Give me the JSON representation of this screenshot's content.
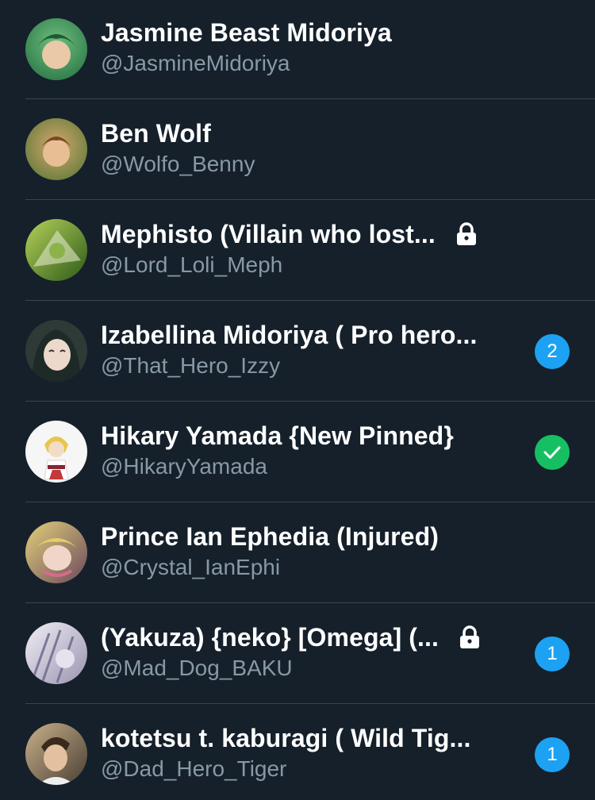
{
  "accounts": [
    {
      "name": "Jasmine Beast Midoriya",
      "handle": "@JasmineMidoriya",
      "locked": false,
      "badge": null,
      "avatar_colors": [
        "#2f7a4a",
        "#6fbf7f"
      ]
    },
    {
      "name": "Ben Wolf",
      "handle": "@Wolfo_Benny",
      "locked": false,
      "badge": null,
      "avatar_colors": [
        "#7a5a2f",
        "#d7a86e"
      ]
    },
    {
      "name": "Mephisto (Villain who lost...",
      "handle": "@Lord_Loli_Meph",
      "locked": true,
      "badge": null,
      "avatar_colors": [
        "#3d6b1f",
        "#b5d15a"
      ]
    },
    {
      "name": "Izabellina Midoriya ( Pro hero...",
      "handle": "@That_Hero_Izzy",
      "locked": false,
      "badge": "2",
      "avatar_colors": [
        "#3a3f3a",
        "#e0cfc2"
      ]
    },
    {
      "name": "Hikary Yamada {New Pinned}",
      "handle": "@HikaryYamada",
      "locked": false,
      "badge": "✓",
      "avatar_colors": [
        "#f4f4f4",
        "#e8c64a"
      ]
    },
    {
      "name": "Prince Ian Ephedia (Injured)",
      "handle": "@Crystal_IanEphi",
      "locked": false,
      "badge": null,
      "avatar_colors": [
        "#6b4a5e",
        "#e3d07a"
      ]
    },
    {
      "name": "(Yakuza) {neko} [Omega] (...",
      "handle": "@Mad_Dog_BAKU",
      "locked": true,
      "badge": "1",
      "avatar_colors": [
        "#b9b4c9",
        "#f0eef5"
      ]
    },
    {
      "name": "kotetsu t. kaburagi ( Wild Tig...",
      "handle": "@Dad_Hero_Tiger",
      "locked": false,
      "badge": "1",
      "avatar_colors": [
        "#6b5a4a",
        "#c9b08a"
      ]
    }
  ],
  "colors": {
    "background": "#15202b",
    "divider": "#38444d",
    "handle_text": "#8899a6",
    "badge_blue": "#1da1f2",
    "badge_green": "#17bf63"
  },
  "icons": {
    "lock": "lock-icon",
    "check": "checkmark-icon"
  }
}
